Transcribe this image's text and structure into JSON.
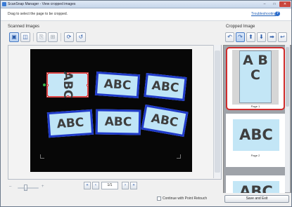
{
  "window": {
    "title": "ScanSnap Manager - View cropped images",
    "controls": {
      "minimize": "–",
      "maximize": "□",
      "close": "✕"
    }
  },
  "info": {
    "instruction": "Drag to select the page to be cropped.",
    "help_link": "Troubleshooting",
    "help_icon": "?"
  },
  "left": {
    "label": "Scanned Images",
    "toolbar": [
      {
        "icon": "single-page-view-icon",
        "glyph": "▣"
      },
      {
        "icon": "double-page-view-icon",
        "glyph": "◫"
      },
      {
        "icon": "scan-page-icon",
        "glyph": "⎘"
      },
      {
        "icon": "book-pages-icon",
        "glyph": "⊞"
      },
      {
        "icon": "rotate-icon",
        "glyph": "⟳"
      },
      {
        "icon": "reset-icon",
        "glyph": "↺"
      }
    ]
  },
  "scan": {
    "cards": [
      {
        "text": "ABC"
      },
      {
        "text": "ABC"
      },
      {
        "text": "ABC"
      },
      {
        "text": "ABC"
      },
      {
        "text": "ABC"
      },
      {
        "text": "ABC"
      }
    ]
  },
  "navigation": {
    "first": "«",
    "prev": "‹",
    "page": "1/1",
    "next": "›",
    "last": "»",
    "zoom_out": "–",
    "zoom_in": "+"
  },
  "right": {
    "label": "Cropped Image",
    "toolbar": [
      {
        "icon": "rotate-left-icon",
        "glyph": "↶"
      },
      {
        "icon": "rotate-right-icon",
        "glyph": "↷"
      },
      {
        "icon": "move-up-icon",
        "glyph": "⬆"
      },
      {
        "icon": "move-down-icon",
        "glyph": "⬇"
      },
      {
        "icon": "next-page-icon",
        "glyph": "➡"
      },
      {
        "icon": "undo-icon",
        "glyph": "↩"
      }
    ],
    "thumbnails": [
      {
        "text": "A B C",
        "caption": "Page 1"
      },
      {
        "text": "ABC",
        "caption": "Page 2"
      },
      {
        "text": "ABC",
        "caption": ""
      }
    ]
  },
  "footer": {
    "checkbox_label": "Continue with Point Retouch",
    "save_button": "Save and Exit"
  },
  "colors": {
    "card_fill": "#bfe5f7",
    "card_border": "#1f3ac9",
    "selection": "#e04545",
    "thumb_selected_border": "#d12b2b"
  }
}
